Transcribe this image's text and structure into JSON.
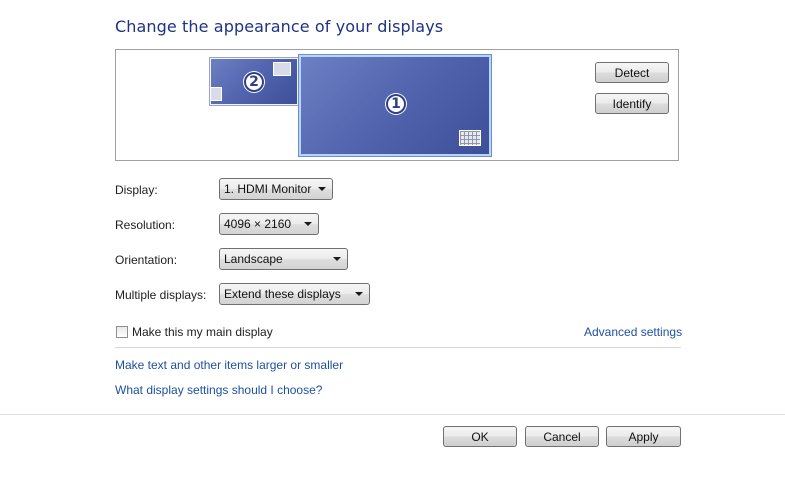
{
  "header": {
    "title": "Change the appearance of your displays"
  },
  "preview": {
    "monitors": [
      {
        "number": "2",
        "icon": "small-window-icon"
      },
      {
        "number": "1",
        "icon": "grid-icon"
      }
    ],
    "detect_label": "Detect",
    "identify_label": "Identify"
  },
  "settings": {
    "display_label": "Display:",
    "display_value": "1. HDMI Monitor",
    "resolution_label": "Resolution:",
    "resolution_value": "4096 × 2160",
    "orientation_label": "Orientation:",
    "orientation_value": "Landscape",
    "multiple_label": "Multiple displays:",
    "multiple_value": "Extend these displays"
  },
  "main_display": {
    "label": "Make this my main display",
    "checked": false
  },
  "links": {
    "advanced": "Advanced settings",
    "text_size": "Make text and other items larger or smaller",
    "which_settings": "What display settings should I choose?"
  },
  "footer": {
    "ok_label": "OK",
    "cancel_label": "Cancel",
    "apply_label": "Apply"
  },
  "colors": {
    "title": "#1e3287",
    "link": "#1e50a0",
    "monitor_fill": "#5466b0"
  }
}
